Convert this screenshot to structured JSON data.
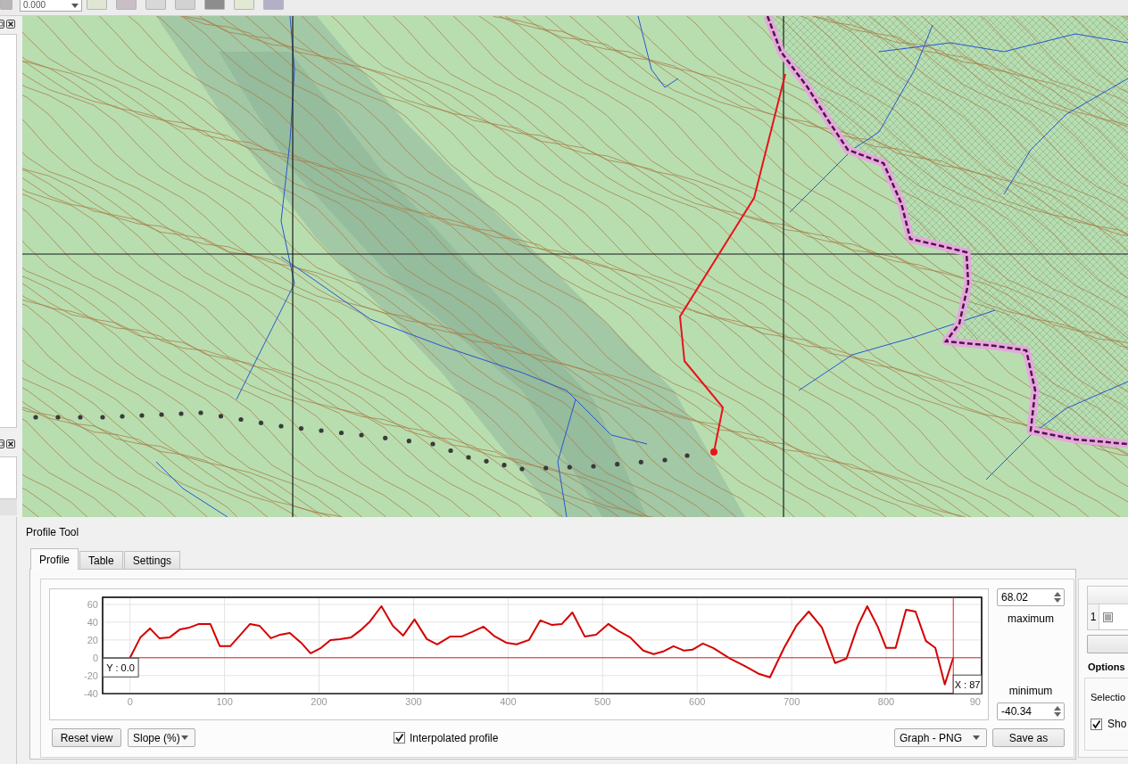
{
  "toolbar": {
    "value_field": {
      "value": "0.000"
    }
  },
  "profile_tool": {
    "title": "Profile Tool",
    "tabs": [
      {
        "label": "Profile",
        "selected": true
      },
      {
        "label": "Table",
        "selected": false
      },
      {
        "label": "Settings",
        "selected": false
      }
    ],
    "chart_data": {
      "type": "line",
      "x": [
        0,
        11,
        21,
        31,
        42,
        53,
        63,
        73,
        85,
        95,
        106,
        117,
        127,
        137,
        149,
        159,
        169,
        181,
        191,
        202,
        212,
        222,
        234,
        244,
        254,
        266,
        278,
        289,
        301,
        314,
        325,
        339,
        351,
        362,
        374,
        386,
        398,
        409,
        422,
        434,
        446,
        457,
        468,
        481,
        493,
        506,
        517,
        529,
        543,
        554,
        564,
        575,
        586,
        595,
        606,
        617,
        635,
        650,
        665,
        677,
        692,
        705,
        718,
        732,
        746,
        758,
        770,
        780,
        791,
        800,
        810,
        821,
        831,
        842,
        852,
        862,
        871
      ],
      "values": [
        0,
        23,
        33,
        22,
        23,
        32,
        34,
        38,
        38,
        13,
        13,
        26,
        38,
        36,
        22,
        26,
        28,
        17,
        5,
        11,
        20,
        21,
        23,
        31,
        41,
        58,
        36,
        25,
        43,
        21,
        15,
        24,
        24,
        29,
        35,
        24,
        17,
        15,
        20,
        42,
        37,
        38,
        51,
        24,
        26,
        38,
        30,
        23,
        8,
        4,
        7,
        13,
        8,
        9,
        16,
        11,
        -1,
        -9,
        -18,
        -22,
        11,
        36,
        52,
        34,
        -6,
        -1,
        36,
        58,
        35,
        11,
        11,
        54,
        52,
        19,
        11,
        -30,
        0
      ],
      "xlim": [
        -29,
        901
      ],
      "ylim": [
        -40.34,
        68.02
      ],
      "xticks": [
        0,
        100,
        200,
        300,
        400,
        500,
        600,
        700,
        800
      ],
      "yticks": [
        -40,
        -20,
        0,
        20,
        40,
        60
      ],
      "grid": true,
      "ref_lines": [
        {
          "axis": "y",
          "value": 0
        },
        {
          "axis": "x",
          "value": 871
        }
      ],
      "annotations": [
        {
          "text": "Y : 0.0",
          "x": -10,
          "y": -11
        },
        {
          "text": "X : 87",
          "x": 886,
          "y": -30
        }
      ]
    },
    "x_axis_edge_label": "90",
    "maximum": {
      "value": "68.02",
      "label": "maximum"
    },
    "minimum": {
      "value": "-40.34",
      "label": "minimum"
    },
    "reset_button": "Reset view",
    "mode_select": {
      "value": "Slope (%)"
    },
    "interpolated_checkbox": {
      "label": "Interpolated profile",
      "checked": true
    },
    "export_select": {
      "value": "Graph - PNG"
    },
    "save_button": "Save as"
  },
  "side_panel": {
    "layers_table": {
      "rows": [
        {
          "number": "1"
        }
      ]
    },
    "options_title": "Options",
    "selection_label": "Selectio",
    "show_checkbox": {
      "label": "Sho",
      "checked": true
    }
  }
}
